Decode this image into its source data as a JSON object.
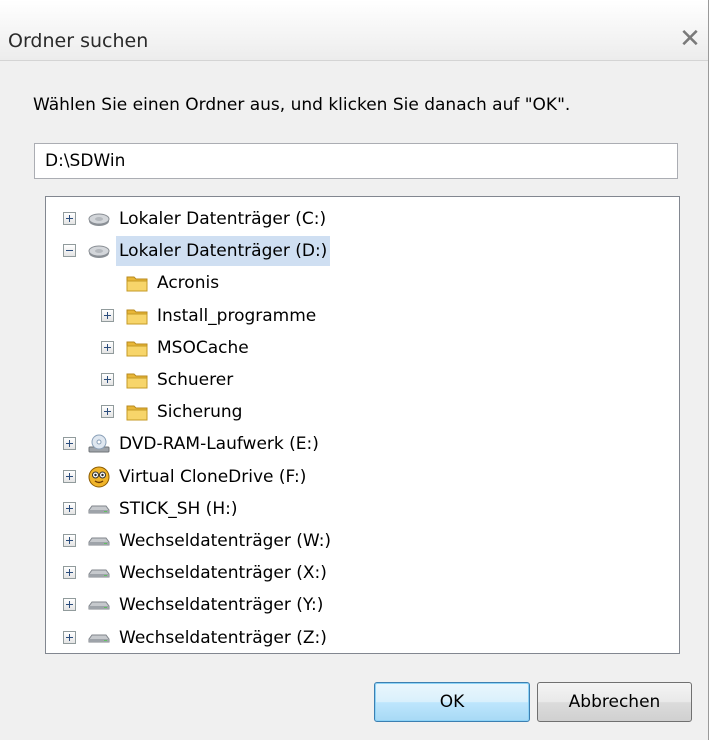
{
  "window": {
    "title": "Ordner suchen",
    "close_glyph": "✕"
  },
  "instruction": "Wählen Sie einen Ordner aus, und klicken Sie danach auf \"OK\".",
  "path_field": {
    "value": "D:\\SDWin"
  },
  "tree": {
    "items": [
      {
        "label": "Lokaler Datenträger (C:)",
        "icon": "hard-drive-icon",
        "expander": "plus",
        "level": 0,
        "selected": false
      },
      {
        "label": "Lokaler Datenträger (D:)",
        "icon": "hard-drive-icon",
        "expander": "minus",
        "level": 0,
        "selected": true
      },
      {
        "label": "Acronis",
        "icon": "folder-icon",
        "expander": "none",
        "level": 1,
        "selected": false
      },
      {
        "label": "Install_programme",
        "icon": "folder-icon",
        "expander": "plus",
        "level": 1,
        "selected": false
      },
      {
        "label": "MSOCache",
        "icon": "folder-icon",
        "expander": "plus",
        "level": 1,
        "selected": false
      },
      {
        "label": "Schuerer",
        "icon": "folder-icon",
        "expander": "plus",
        "level": 1,
        "selected": false
      },
      {
        "label": "Sicherung",
        "icon": "folder-icon",
        "expander": "plus",
        "level": 1,
        "selected": false
      },
      {
        "label": "DVD-RAM-Laufwerk (E:)",
        "icon": "dvd-drive-icon",
        "expander": "plus",
        "level": 0,
        "selected": false
      },
      {
        "label": "Virtual CloneDrive (F:)",
        "icon": "virtual-drive-icon",
        "expander": "plus",
        "level": 0,
        "selected": false
      },
      {
        "label": "STICK_SH (H:)",
        "icon": "removable-drive-icon",
        "expander": "plus",
        "level": 0,
        "selected": false
      },
      {
        "label": "Wechseldatenträger (W:)",
        "icon": "removable-drive-icon",
        "expander": "plus",
        "level": 0,
        "selected": false
      },
      {
        "label": "Wechseldatenträger (X:)",
        "icon": "removable-drive-icon",
        "expander": "plus",
        "level": 0,
        "selected": false
      },
      {
        "label": "Wechseldatenträger (Y:)",
        "icon": "removable-drive-icon",
        "expander": "plus",
        "level": 0,
        "selected": false
      },
      {
        "label": "Wechseldatenträger (Z:)",
        "icon": "removable-drive-icon",
        "expander": "plus",
        "level": 0,
        "selected": false
      }
    ]
  },
  "buttons": {
    "ok_label": "OK",
    "cancel_label": "Abbrechen"
  },
  "colors": {
    "selection": "#cfdff2",
    "folder": "#f5c542",
    "default_button": "#bee6fd"
  }
}
